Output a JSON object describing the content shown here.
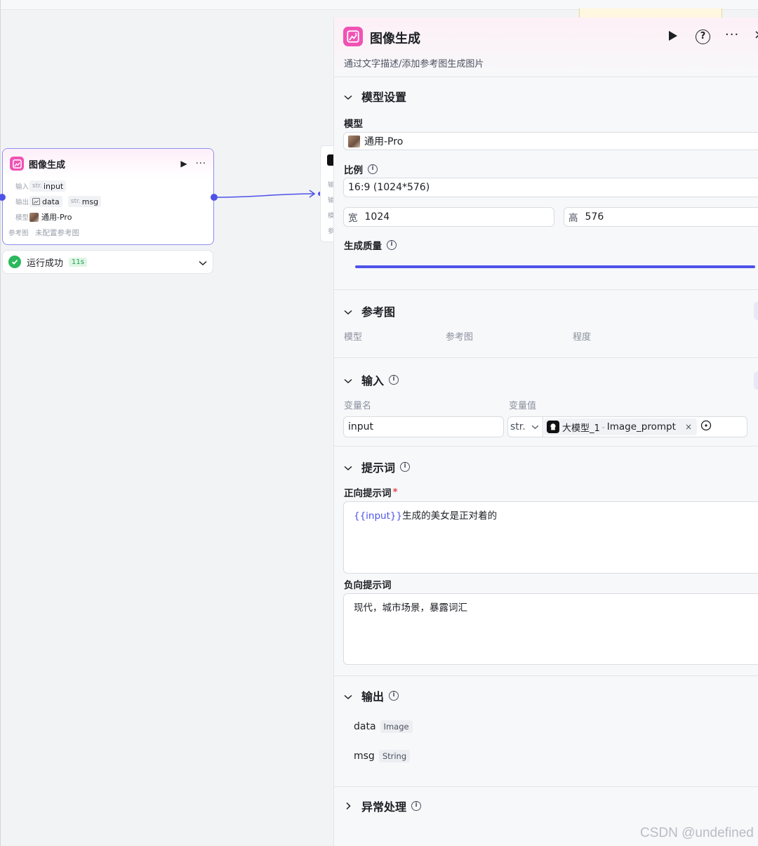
{
  "node": {
    "title": "图像生成",
    "input_label": "输入",
    "input_type": "str.",
    "input_name": "input",
    "output_label": "输出",
    "output_data": "data",
    "output_msg_type": "str.",
    "output_msg": "msg",
    "model_label": "模型",
    "model_value": "通用-Pro",
    "ref_label": "参考图",
    "ref_value": "未配置参考图"
  },
  "status": {
    "text": "运行成功",
    "time": "11s"
  },
  "stub": {
    "labels": [
      "输",
      "输",
      "模",
      "参"
    ]
  },
  "panel": {
    "title": "图像生成",
    "description": "通过文字描述/添加参考图生成图片",
    "model_settings": {
      "title": "模型设置",
      "model_label": "模型",
      "model_value": "通用-Pro",
      "ratio_label": "比例",
      "ratio_value": "16:9 (1024*576)",
      "width_label": "宽",
      "width_value": "1024",
      "height_label": "高",
      "height_value": "576",
      "quality_label": "生成质量",
      "quality_fraction": 1.0
    },
    "reference": {
      "title": "参考图",
      "col_model": "模型",
      "col_image": "参考图",
      "col_degree": "程度"
    },
    "inputs": {
      "title": "输入",
      "col_name": "变量名",
      "col_value": "变量值",
      "var_name": "input",
      "var_type": "str.",
      "ref_node": "大模型_1",
      "ref_sep": "-",
      "ref_var": "Image_prompt"
    },
    "prompt": {
      "title": "提示词",
      "positive_label": "正向提示词",
      "required_mark": "*",
      "positive_var": "{{input}}",
      "positive_text": "生成的美女是正对着的",
      "negative_label": "负向提示词",
      "negative_text": "现代，城市场景，暴露词汇"
    },
    "output": {
      "title": "输出",
      "items": [
        {
          "name": "data",
          "type": "Image"
        },
        {
          "name": "msg",
          "type": "String"
        }
      ]
    },
    "exception": {
      "title": "异常处理"
    }
  },
  "watermark": "CSDN @undefined",
  "colors": {
    "accent": "#4d53e8",
    "node_icon": "#f052b4",
    "success": "#2cb85c"
  }
}
